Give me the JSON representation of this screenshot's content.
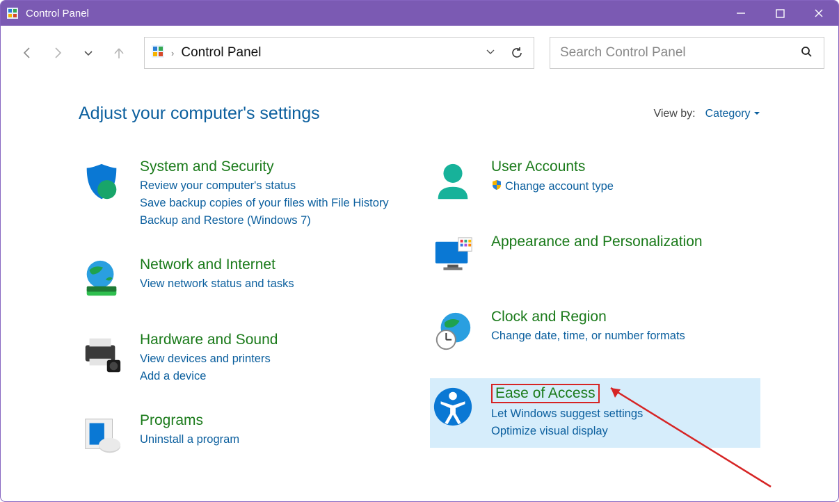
{
  "window": {
    "title": "Control Panel"
  },
  "address": {
    "location": "Control Panel"
  },
  "search": {
    "placeholder": "Search Control Panel"
  },
  "heading": "Adjust your computer's settings",
  "viewby": {
    "label": "View by:",
    "value": "Category"
  },
  "cats": {
    "system": {
      "title": "System and Security",
      "links": [
        "Review your computer's status",
        "Save backup copies of your files with File History",
        "Backup and Restore (Windows 7)"
      ]
    },
    "network": {
      "title": "Network and Internet",
      "links": [
        "View network status and tasks"
      ]
    },
    "hardware": {
      "title": "Hardware and Sound",
      "links": [
        "View devices and printers",
        "Add a device"
      ]
    },
    "programs": {
      "title": "Programs",
      "links": [
        "Uninstall a program"
      ]
    },
    "users": {
      "title": "User Accounts",
      "links": [
        "Change account type"
      ]
    },
    "appearance": {
      "title": "Appearance and Personalization"
    },
    "clock": {
      "title": "Clock and Region",
      "links": [
        "Change date, time, or number formats"
      ]
    },
    "ease": {
      "title": "Ease of Access",
      "links": [
        "Let Windows suggest settings",
        "Optimize visual display"
      ]
    }
  }
}
